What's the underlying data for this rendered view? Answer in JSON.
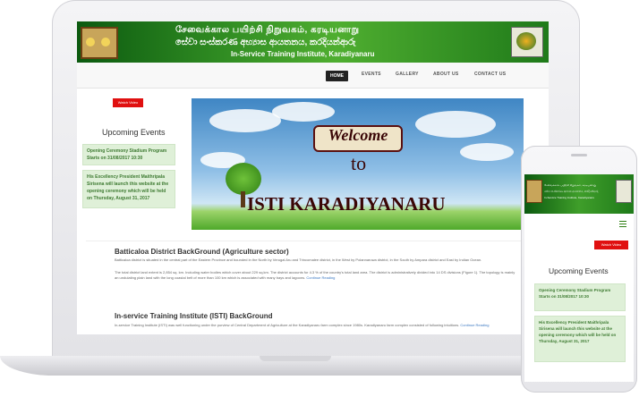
{
  "banner": {
    "line1": "சேவைக்கால பயிற்சி நிறுவகம், கரடியனாறு",
    "line2": "සේවා සංස්කරණ අභ්‍යාස ආයතනය, කරදියන්ආරු",
    "line3": "In-Service Training Institute, Karadiyanaru"
  },
  "nav": {
    "items": [
      "HOME",
      "EVENTS",
      "GALLERY",
      "ABOUT US",
      "CONTACT US"
    ],
    "active": "HOME"
  },
  "sidebar": {
    "video_button": "Watch Video",
    "title": "Upcoming Events",
    "events": [
      "Opening Ceremony Stadium Program Starts on 31/08/2017 10:30",
      "His Excellency President Maithripala Sirisena will launch this website at the opening ceremony which will be held on Thursday, August 31, 2017"
    ]
  },
  "hero": {
    "welcome": "Welcome",
    "to": "to",
    "name": "ISTI KARADIYANARU"
  },
  "articles": [
    {
      "title": "Batticaloa District BackGround (Agriculture sector)",
      "p1": "Batticaloa district is situated in the central part of the Eastern Province and bounded in the North by Verugal Aru and Trincomalee district, in the West by Polannaruwa district, in the South by Ampara district and East by Indian Ocean.",
      "p2": "The total district land extent is 2,854 sq. km. Including water bodies which cover about 229 sq.km. The district accounts for 4.3 % of the country's total land area. The district is administratively divided into 14 DS divisions (Figure 1). The topology is mainly an undulating plain land with the long coastal belt of more than 100 km which is associated with many bays and lagoons.",
      "more": "Continue Reading"
    },
    {
      "title": "In-service Training Institute (ISTI) BackGround",
      "p1": "In-service Training Institute (ISTI) was well functioning under the purview of Central Department of Agriculture at the Karadiyanaru farm complex since 1980s. Karadiyanaru farm complex consisted of following intuitions.",
      "more": "Continue Reading"
    }
  ],
  "mobile": {
    "title_line1": "சேவைக்கால பயிற்சி நிறுவகம், கரடியனாறு",
    "title_line2": "සේවා සංස්කරණ අභ්‍යාස ආයතනය, කරදියන්ආරු",
    "title_line3": "In-Service Training Institute, Karadiyanaru",
    "video_button": "Watch Video",
    "events_title": "Upcoming Events",
    "events": [
      "Opening Ceremony Stadium Program Starts on 31/08/2017 10:30",
      "His Excellency President Maithripala Sirisena will launch this website at the opening ceremony which will be held on Thursday, August 31, 2017"
    ]
  },
  "colors": {
    "banner_green": "#2f8b22",
    "event_bg": "#dff0d8",
    "event_text": "#3d7a31",
    "video_red": "#e01010",
    "link_blue": "#3b78c2"
  }
}
